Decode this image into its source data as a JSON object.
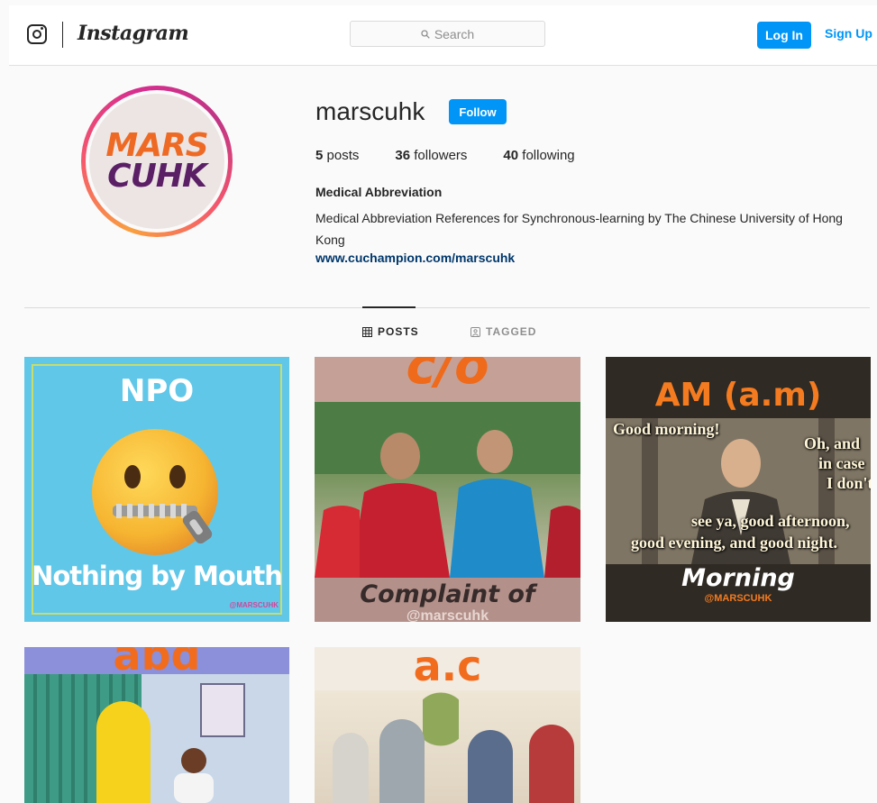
{
  "header": {
    "brand": "Instagram",
    "search_placeholder": "Search",
    "login_label": "Log In",
    "signup_label": "Sign Up"
  },
  "profile": {
    "username": "marscuhk",
    "follow_label": "Follow",
    "avatar_text_line1": "MARS",
    "avatar_text_line2": "CUHK",
    "posts_count": "5",
    "posts_label": "posts",
    "followers_count": "36",
    "followers_label": "followers",
    "following_count": "40",
    "following_label": "following",
    "full_name": "Medical Abbreviation",
    "bio": "Medical Abbreviation References for Synchronous-learning by The Chinese University of Hong Kong",
    "website": "www.cuchampion.com/marscuhk"
  },
  "tabs": [
    {
      "label": "POSTS",
      "active": true
    },
    {
      "label": "TAGGED",
      "active": false
    }
  ],
  "posts": [
    {
      "title": "NPO",
      "caption": "Nothing by Mouth",
      "handle": "@MARSCUHK"
    },
    {
      "title": "c/o",
      "caption": "Complaint of",
      "handle": "@marscuhk"
    },
    {
      "title": "AM (a.m)",
      "caption": "Morning",
      "handle": "@MARSCUHK",
      "quote_lines": [
        "Good morning!",
        "Oh, and",
        "in case",
        "I don't",
        "see ya, good afternoon,",
        "good evening, and good night."
      ]
    },
    {
      "title": "abd"
    },
    {
      "title": "a.c"
    }
  ],
  "colors": {
    "accent": "#0095f6",
    "link": "#00376b",
    "text": "#262626",
    "muted": "#8e8e8e"
  }
}
